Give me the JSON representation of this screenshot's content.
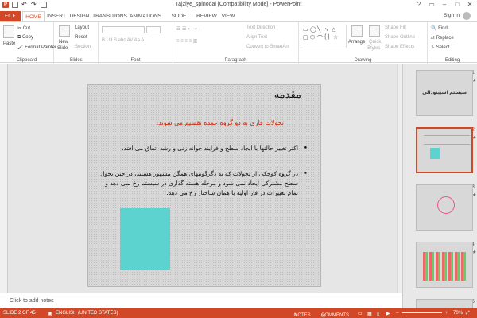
{
  "window": {
    "title": "Tajziye_spinodal [Compatibility Mode] - PowerPoint",
    "app_badge": "P"
  },
  "tabs": [
    {
      "label": "FILE"
    },
    {
      "label": "HOME"
    },
    {
      "label": "INSERT"
    },
    {
      "label": "DESIGN"
    },
    {
      "label": "TRANSITIONS"
    },
    {
      "label": "ANIMATIONS"
    },
    {
      "label": "SLIDE SHOW"
    },
    {
      "label": "REVIEW"
    },
    {
      "label": "VIEW"
    }
  ],
  "account": {
    "signin": "Sign in"
  },
  "ribbon": {
    "clipboard": {
      "label": "Clipboard",
      "paste": "Paste",
      "cut": "Cut",
      "copy": "Copy",
      "format_painter": "Format Painter"
    },
    "slides": {
      "label": "Slides",
      "new_slide": "New",
      "new_slide_2": "Slide",
      "layout": "Layout",
      "reset": "Reset",
      "section": "Section"
    },
    "font": {
      "label": "Font"
    },
    "paragraph": {
      "label": "Paragraph",
      "text_direction": "Text Direction",
      "align_text": "Align Text",
      "convert_smartart": "Convert to SmartArt"
    },
    "drawing": {
      "label": "Drawing",
      "arrange": "Arrange",
      "quick_styles": "Quick",
      "quick_styles_2": "Styles",
      "shape_fill": "Shape Fill",
      "shape_outline": "Shape Outline",
      "shape_effects": "Shape Effects"
    },
    "editing": {
      "label": "Editing",
      "find": "Find",
      "replace": "Replace",
      "select": "Select"
    }
  },
  "slide": {
    "title": "مقدمه",
    "subtitle": "تحولات فازی به دو گروه عمده تقسیم می شوند:",
    "bullet1": "اکثر تغییر حالتها با ایجاد سطح و فرآیند جوانه زنی و رشد اتفاق می افتد.",
    "bullet2": "در گروه کوچکی از تحولات که به دگرگونیهای همگن مشهور هستند، در حین تحول سطح مشترکی ایجاد نمی شود و مرحله هسته گذاری در سیستم رخ نمی دهد و تمام تغییرات در فاز اولیه با همان ساختار رخ می دهد.",
    "shape_color": "#5cd3cf"
  },
  "notes": {
    "placeholder": "Click to add notes"
  },
  "thumbnails": [
    {
      "num": "1",
      "text": "سیستم اسپینودالی"
    },
    {
      "num": "2",
      "text": ""
    },
    {
      "num": "3",
      "text": ""
    },
    {
      "num": "4",
      "text": ""
    },
    {
      "num": "5",
      "text": ""
    }
  ],
  "status": {
    "slide_info": "SLIDE 2 OF 45",
    "language": "ENGLISH (UNITED STATES)",
    "notes": "NOTES",
    "comments": "COMMENTS",
    "zoom": "70%"
  },
  "colors": {
    "accent": "#d24726",
    "slide_title": "#111111",
    "subtitle": "#cc2200"
  }
}
